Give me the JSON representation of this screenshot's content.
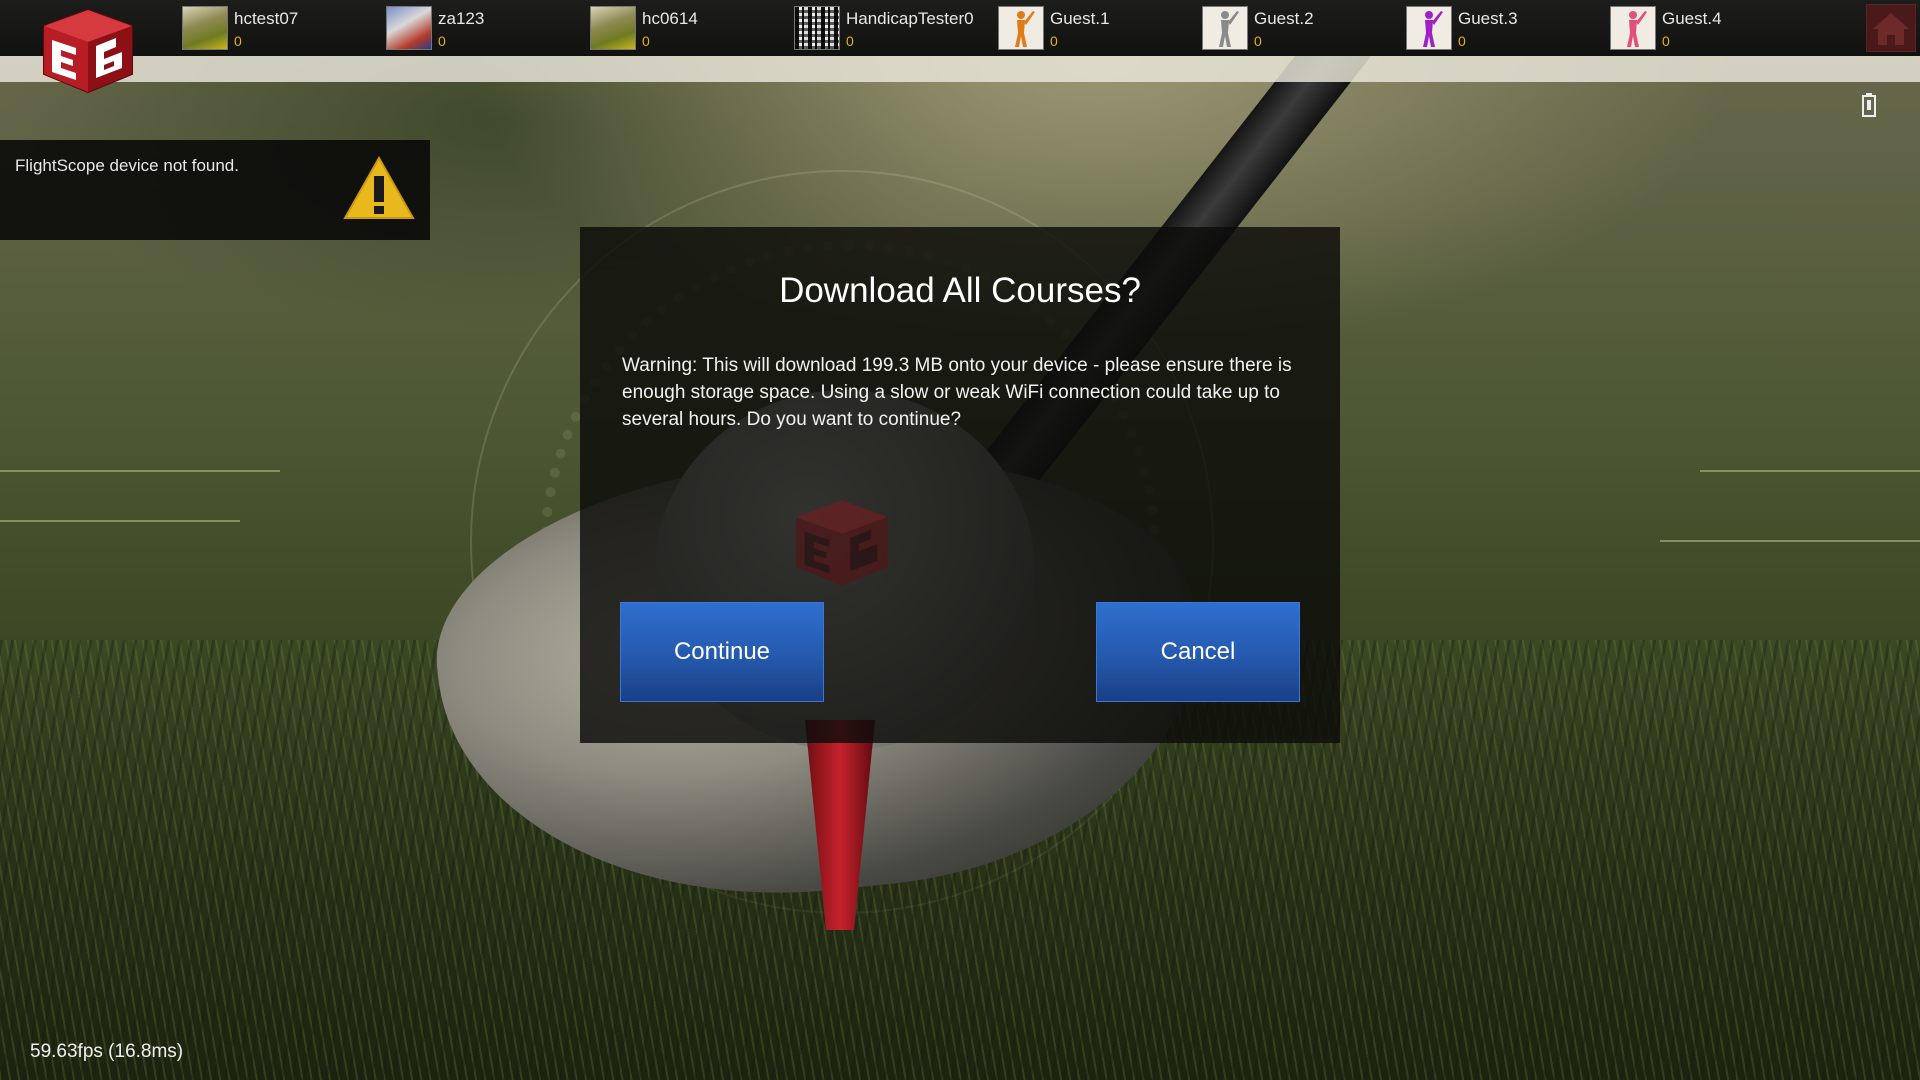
{
  "topbar": {
    "players": [
      {
        "name": "hctest07",
        "score": "0",
        "avatar": "photo-avatar"
      },
      {
        "name": "za123",
        "score": "0",
        "avatar": "photo-avatar"
      },
      {
        "name": "hc0614",
        "score": "0",
        "avatar": "photo-avatar"
      },
      {
        "name": "HandicapTester0",
        "score": "0",
        "avatar": "qr-avatar"
      },
      {
        "name": "Guest.1",
        "score": "0",
        "avatar": "golfer-icon",
        "color": "#e07b1a"
      },
      {
        "name": "Guest.2",
        "score": "0",
        "avatar": "golfer-icon",
        "color": "#8a8a8a"
      },
      {
        "name": "Guest.3",
        "score": "0",
        "avatar": "golfer-icon",
        "color": "#a020c8"
      },
      {
        "name": "Guest.4",
        "score": "0",
        "avatar": "golfer-icon",
        "color": "#e0507a"
      }
    ],
    "home_icon": "home-icon",
    "battery_icon": "battery-icon"
  },
  "notification": {
    "message": "FlightScope device not found.",
    "icon": "warning-icon"
  },
  "dialog": {
    "title": "Download All Courses?",
    "body": "Warning: This will download 199.3 MB onto your device - please ensure there is enough storage space. Using a slow or weak WiFi connection could take up to several hours. Do you want to continue?",
    "continue_label": "Continue",
    "cancel_label": "Cancel"
  },
  "footer": {
    "fps": "59.63fps (16.8ms)"
  },
  "colors": {
    "button_blue": "#2559ad",
    "score_gold": "#e2b21b",
    "logo_red": "#c8202a"
  }
}
